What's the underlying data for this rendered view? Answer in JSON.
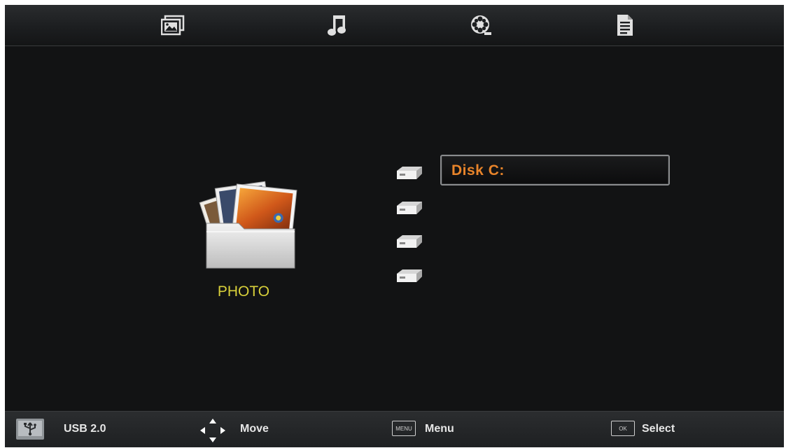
{
  "top_tabs": [
    {
      "name": "photo",
      "icon": "photo-icon"
    },
    {
      "name": "music",
      "icon": "music-note-icon"
    },
    {
      "name": "movie",
      "icon": "film-reel-icon"
    },
    {
      "name": "text",
      "icon": "document-icon"
    }
  ],
  "category": {
    "label": "PHOTO",
    "icon": "photo-folder-icon"
  },
  "drives": [
    {
      "label": "Disk C:",
      "selected": true,
      "icon": "drive-icon"
    },
    {
      "label": "",
      "icon": "drive-icon"
    },
    {
      "label": "",
      "icon": "drive-icon"
    },
    {
      "label": "",
      "icon": "drive-icon"
    }
  ],
  "footer": {
    "usb_label": "USB 2.0",
    "move_label": "Move",
    "menu_key": "MENU",
    "menu_label": "Menu",
    "ok_key": "OK",
    "select_label": "Select"
  },
  "colors": {
    "accent": "#e8842a",
    "category_label": "#d8d03a",
    "background": "#121314"
  }
}
